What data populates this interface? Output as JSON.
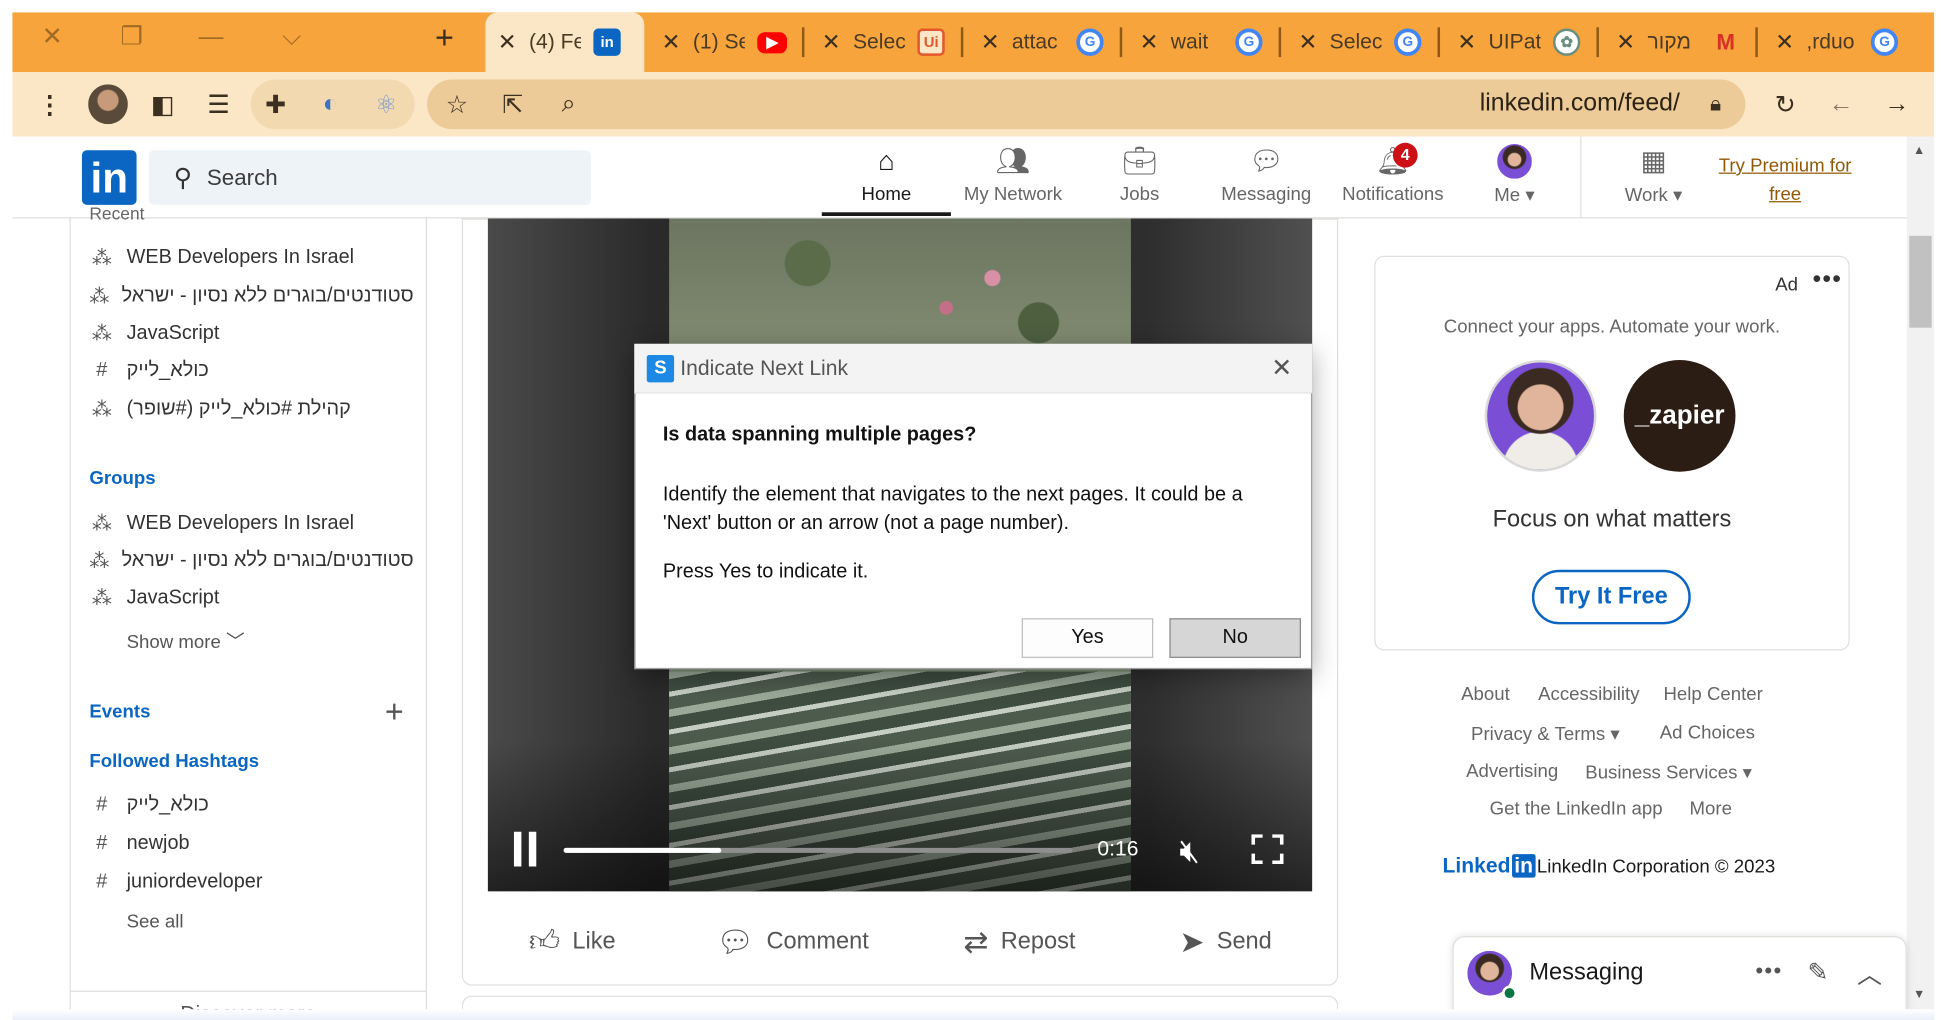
{
  "browser": {
    "tabs": [
      {
        "title": "(4) Fe",
        "favicon": "linkedin-icon",
        "active": true
      },
      {
        "title": "(1) Se",
        "favicon": "youtube-icon",
        "active": false
      },
      {
        "title": "Selec",
        "favicon": "uipath-icon",
        "active": false
      },
      {
        "title": "attac",
        "favicon": "google-icon",
        "active": false
      },
      {
        "title": "wait",
        "favicon": "google-icon",
        "active": false
      },
      {
        "title": "Selec",
        "favicon": "google-icon",
        "active": false
      },
      {
        "title": "UIPat",
        "favicon": "chatgpt-icon",
        "active": false
      },
      {
        "title": "מקור",
        "favicon": "gmail-icon",
        "active": false
      },
      {
        "title": ",rduo",
        "favicon": "google-icon",
        "active": false
      }
    ],
    "url": "linkedin.com/feed/",
    "theme_color": "#f7a43d"
  },
  "linkedin": {
    "logo_text": "in",
    "search_placeholder": "Search",
    "nav": [
      {
        "label": "Home",
        "icon": "home-icon",
        "active": true
      },
      {
        "label": "My Network",
        "icon": "network-icon"
      },
      {
        "label": "Jobs",
        "icon": "briefcase-icon"
      },
      {
        "label": "Messaging",
        "icon": "chat-icon"
      },
      {
        "label": "Notifications",
        "icon": "bell-icon",
        "badge": "4"
      },
      {
        "label": "Me",
        "icon": "avatar-icon"
      },
      {
        "label": "Work",
        "icon": "grid-icon"
      }
    ],
    "premium_link": "Try Premium for free",
    "brand_color": "#0a66c2"
  },
  "sidebar": {
    "recent_label": "Recent",
    "recent": [
      {
        "label": "WEB Developers In Israel",
        "icon": "group-icon"
      },
      {
        "label": "סטודנטים/בוגרים ללא נסיון - ישראל...",
        "icon": "group-icon"
      },
      {
        "label": "JavaScript",
        "icon": "group-icon"
      },
      {
        "label": "כולא_לייק",
        "icon": "hashtag-icon"
      },
      {
        "label": "קהילת #כולא_לייק (#שופר)",
        "icon": "group-icon"
      }
    ],
    "groups_heading": "Groups",
    "groups": [
      {
        "label": "WEB Developers In Israel"
      },
      {
        "label": "סטודנטים/בוגרים ללא נסיון - ישראל..."
      },
      {
        "label": "JavaScript"
      }
    ],
    "show_more": "Show more",
    "events_heading": "Events",
    "hashtags_heading": "Followed Hashtags",
    "hashtags": [
      {
        "label": "כולא_לייק"
      },
      {
        "label": "newjob"
      },
      {
        "label": "juniordeveloper"
      }
    ],
    "see_all": "See all",
    "discover_more": "Discover more"
  },
  "video": {
    "time": "0:16",
    "progress": 0.31
  },
  "post_actions": [
    {
      "label": "Like",
      "icon": "thumbs-up-icon"
    },
    {
      "label": "Comment",
      "icon": "comment-icon"
    },
    {
      "label": "Repost",
      "icon": "repost-icon"
    },
    {
      "label": "Send",
      "icon": "send-icon"
    }
  ],
  "ad": {
    "label": "Ad",
    "tagline": "Connect your apps. Automate your work.",
    "brand": "_zapier",
    "headline": "Focus on what matters",
    "cta": "Try It Free"
  },
  "footer": {
    "links": [
      "About",
      "Accessibility",
      "Help Center",
      "Privacy & Terms",
      "Ad Choices",
      "Advertising",
      "Business Services",
      "Get the LinkedIn app",
      "More"
    ],
    "logo_text": "Linked",
    "logo_in": "in",
    "copyright": "LinkedIn Corporation © 2023"
  },
  "messaging": {
    "title": "Messaging"
  },
  "dialog": {
    "title": "Indicate Next Link",
    "question": "Is data spanning multiple pages?",
    "body": "Identify the element that navigates to the next pages. It could be a 'Next' button or an arrow (not a page number).",
    "instruction": "Press Yes to indicate it.",
    "yes_label": "Yes",
    "no_label": "No"
  }
}
